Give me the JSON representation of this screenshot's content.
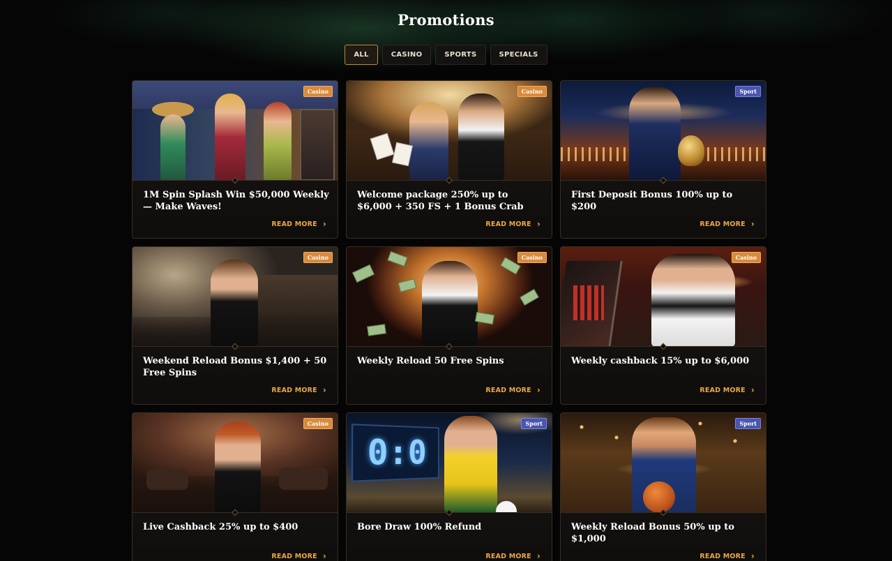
{
  "page": {
    "title": "Promotions"
  },
  "filters": [
    {
      "label": "ALL",
      "active": true
    },
    {
      "label": "CASINO",
      "active": false
    },
    {
      "label": "SPORTS",
      "active": false
    },
    {
      "label": "SPECIALS",
      "active": false
    }
  ],
  "read_more_label": "READ MORE",
  "promotions": [
    {
      "title": "1M Spin Splash Win $50,000 Weekly — Make Waves!",
      "badge": "Casino",
      "badge_type": "casino",
      "image": "three-women-slots-illustration"
    },
    {
      "title": "Welcome package 250% up to $6,000 + 350 FS + 1 Bonus Crab",
      "badge": "Casino",
      "badge_type": "casino",
      "image": "couple-casino-illustration"
    },
    {
      "title": "First Deposit Bonus 100% up to $200",
      "badge": "Sport",
      "badge_type": "sport",
      "image": "footballer-trophy-illustration"
    },
    {
      "title": "Weekend Reload Bonus $1,400 + 50 Free Spins",
      "badge": "Casino",
      "badge_type": "casino",
      "image": "woman-black-dress-illustration"
    },
    {
      "title": "Weekly Reload 50 Free Spins",
      "badge": "Casino",
      "badge_type": "casino",
      "image": "man-tuxedo-money-illustration"
    },
    {
      "title": "Weekly cashback 15% up to $6,000",
      "badge": "Casino",
      "badge_type": "casino",
      "image": "dealer-slot-machine-illustration"
    },
    {
      "title": "Live Cashback 25% up to $400",
      "badge": "Casino",
      "badge_type": "casino",
      "image": "woman-live-casino-illustration"
    },
    {
      "title": "Bore Draw 100% Refund",
      "badge": "Sport",
      "badge_type": "sport",
      "image": "footballer-scoreboard-illustration"
    },
    {
      "title": "Weekly Reload Bonus 50% up to $1,000",
      "badge": "Sport",
      "badge_type": "sport",
      "image": "basketball-player-illustration"
    }
  ],
  "scoreboard_text": "0:0",
  "colors": {
    "accent": "#e8a845",
    "casino_badge": "#d98a3a",
    "sport_badge": "#4a55b0",
    "background": "#050505"
  }
}
